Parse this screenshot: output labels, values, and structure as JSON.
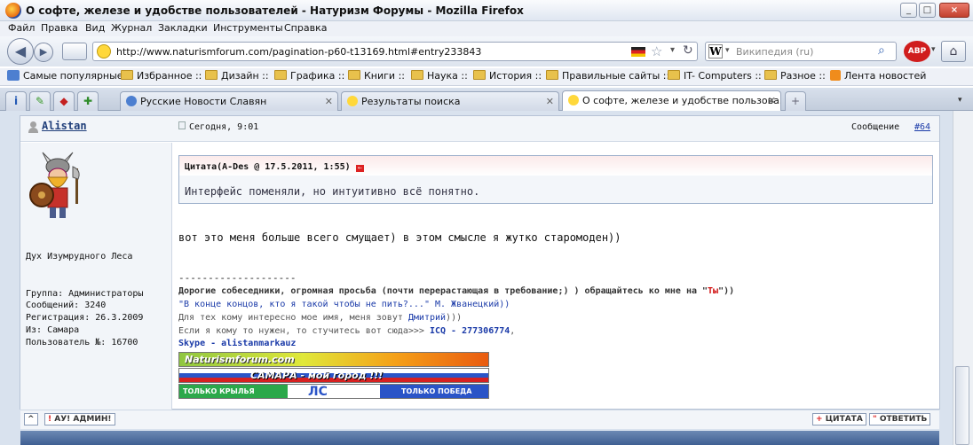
{
  "window": {
    "title": "О софте, железе и удобстве пользователей - Натуризм Форумы - Mozilla Firefox",
    "min": "_",
    "max": "□",
    "close": "×"
  },
  "menu": [
    "Файл",
    "Правка",
    "Вид",
    "Журнал",
    "Закладки",
    "Инструменты",
    "Справка"
  ],
  "nav": {
    "url": "http://www.naturismforum.com/pagination-p60-t13169.html#entry233843",
    "search_placeholder": "Википедия (ru)",
    "abp": "ABP"
  },
  "bookmarks": [
    "Самые популярные",
    "Избранное ::",
    "Дизайн ::",
    "Графика ::",
    "Книги ::",
    "Наука ::",
    "История ::",
    "Правильные сайты ::",
    "IT- Computers ::",
    "Разное ::",
    "Лента новостей"
  ],
  "tabs": [
    {
      "label": "Русские Новости Славян"
    },
    {
      "label": "Результаты поиска"
    },
    {
      "label": "О софте, железе и удобстве пользова..."
    }
  ],
  "post": {
    "author": "Alistan",
    "date": "Сегодня, 9:01",
    "msg_label": "Сообщение",
    "msg_num": "#64",
    "user_title": "Дух Изумрудного Леса",
    "group": "Группа: Администраторы",
    "posts": "Сообщений: 3240",
    "reg": "Регистрация: 26.3.2009",
    "from": "Из: Самара",
    "user_no": "Пользователь №: 16700",
    "quote_head": "Цитата(A-Des @ 17.5.2011, 1:55)",
    "quote_text": "Интерфейс поменяли, но интуитивно всё понятно.",
    "body": "вот это меня больше всего смущает) в этом смысле я жутко старомоден))",
    "sig_sep": "--------------------",
    "sig1a": "Дорогие собеседники, огромная просьба (почти перерастающая в требование;) ) обращайтесь ко мне на \"",
    "sig1b": "Ты",
    "sig1c": "\"))",
    "sig2": "\"В конце концов, кто я такой чтобы не пить?...\" М. Жванецкий))",
    "sig3a": "Для тех кому интересно мое имя, меня зовут ",
    "sig3b": "Дмитрий",
    "sig3c": ")))",
    "sig4a": "Если я кому то нужен, то стучитесь вот сюда>>> ",
    "sig4b": "ICQ - 277306774",
    "sig4c": ",",
    "sig5": "Skype - alistanmarkauz",
    "banner1": "Naturismforum.com",
    "banner2": "САМАРА - мой город !!!",
    "banner3a": "ТОЛЬКО КРЫЛЬЯ",
    "banner3b": "ТОЛЬКО ПОБЕДА"
  },
  "footer": {
    "up": "^",
    "report": "АУ! АДМИН!",
    "quote": "ЦИТАТА",
    "reply": "ОТВЕТИТЬ"
  }
}
